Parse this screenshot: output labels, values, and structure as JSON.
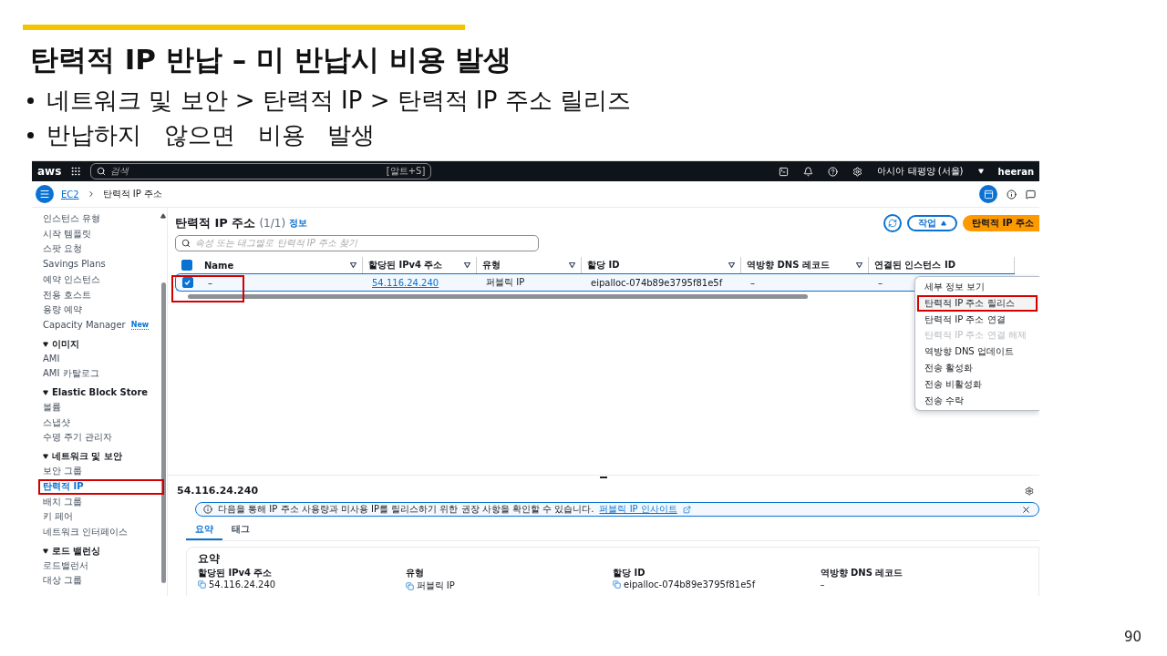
{
  "slide": {
    "title": "탄력적 IP 반납 – 미 반납시 비용 발생",
    "bullets": [
      "네트워크 및 보안 > 탄력적 IP > 탄력적 IP 주소 릴리즈",
      "반납하지   않으면   비용   발생"
    ],
    "page_number": "90"
  },
  "console": {
    "top_bar": {
      "logo": "aws",
      "search_placeholder": "검색",
      "shortcut": "[알트+S]",
      "region": "아시아 태평양 (서울)",
      "user": "heeran"
    },
    "breadcrumb": [
      {
        "label": "EC2",
        "link": true
      },
      {
        "label": "탄력적 IP 주소",
        "link": false
      }
    ],
    "sidebar": {
      "items": [
        {
          "kind": "link",
          "label": "인스턴스 유형",
          "selected": false,
          "annotated": false
        },
        {
          "kind": "link",
          "label": "시작 템플릿",
          "selected": false,
          "annotated": false
        },
        {
          "kind": "link",
          "label": "스팟 요청",
          "selected": false,
          "annotated": false
        },
        {
          "kind": "link",
          "label": "Savings Plans",
          "selected": false,
          "annotated": false
        },
        {
          "kind": "link",
          "label": "예약 인스턴스",
          "selected": false,
          "annotated": false
        },
        {
          "kind": "link",
          "label": "전용 호스트",
          "selected": false,
          "annotated": false
        },
        {
          "kind": "link",
          "label": "용량 예약",
          "selected": false,
          "annotated": false
        },
        {
          "kind": "link",
          "label": "Capacity Manager",
          "badge": "New",
          "selected": false,
          "annotated": false
        },
        {
          "kind": "section",
          "label": "이미지",
          "expanded": true,
          "children": [
            {
              "kind": "link",
              "label": "AMI",
              "selected": false,
              "annotated": false
            },
            {
              "kind": "link",
              "label": "AMI 카탈로그",
              "selected": false,
              "annotated": false
            }
          ]
        },
        {
          "kind": "section",
          "label": "Elastic Block Store",
          "expanded": true,
          "children": [
            {
              "kind": "link",
              "label": "볼륨",
              "selected": false,
              "annotated": false
            },
            {
              "kind": "link",
              "label": "스냅샷",
              "selected": false,
              "annotated": false
            },
            {
              "kind": "link",
              "label": "수명 주기 관리자",
              "selected": false,
              "annotated": false
            }
          ]
        },
        {
          "kind": "section",
          "label": "네트워크 및 보안",
          "expanded": true,
          "children": [
            {
              "kind": "link",
              "label": "보안 그룹",
              "selected": false,
              "annotated": false
            },
            {
              "kind": "link",
              "label": "탄력적 IP",
              "selected": true,
              "annotated": true
            },
            {
              "kind": "link",
              "label": "배치 그룹",
              "selected": false,
              "annotated": false
            },
            {
              "kind": "link",
              "label": "키 페어",
              "selected": false,
              "annotated": false
            },
            {
              "kind": "link",
              "label": "네트워크 인터페이스",
              "selected": false,
              "annotated": false
            }
          ]
        },
        {
          "kind": "section",
          "label": "로드 밸런싱",
          "expanded": true,
          "children": [
            {
              "kind": "link",
              "label": "로드밸런서",
              "selected": false,
              "annotated": false
            },
            {
              "kind": "link",
              "label": "대상 그룹",
              "selected": false,
              "annotated": false
            }
          ]
        }
      ]
    },
    "list": {
      "title": "탄력적 IP 주소",
      "count": "(1/1)",
      "info": "정보",
      "actions_button": "작업",
      "actions_expanded": true,
      "primary_button": "탄력적 IP 주소",
      "search_placeholder": "속성 또는 태그별로 탄력적 IP 주소 찾기",
      "all_checked": true,
      "columns": [
        {
          "label": "Name",
          "kind": "text"
        },
        {
          "label": "할당된 IPv4 주소",
          "kind": "link"
        },
        {
          "label": "유형",
          "kind": "text"
        },
        {
          "label": "할당 ID",
          "kind": "text"
        },
        {
          "label": "역방향 DNS 레코드",
          "kind": "text"
        },
        {
          "label": "연결된 인스턴스 ID",
          "kind": "text"
        }
      ],
      "rows": [
        {
          "cells": [
            "–",
            "54.116.24.240",
            "퍼블릭 IP",
            "eipalloc-074b89e3795f81e5f",
            "–",
            "–"
          ],
          "selected": true,
          "annotated": true
        }
      ]
    },
    "actions_menu": [
      {
        "label": "세부 정보 보기",
        "disabled": false,
        "annotated": false
      },
      {
        "label": "탄력적 IP 주소 릴리스",
        "disabled": false,
        "annotated": true
      },
      {
        "label": "탄력적 IP 주소 연결",
        "disabled": false,
        "annotated": false
      },
      {
        "label": "탄력적 IP 주소 연결 해제",
        "disabled": true,
        "annotated": false
      },
      {
        "label": "역방향 DNS 업데이트",
        "disabled": false,
        "annotated": false
      },
      {
        "label": "전송 활성화",
        "disabled": false,
        "annotated": false
      },
      {
        "label": "전송 비활성화",
        "disabled": false,
        "annotated": false
      },
      {
        "label": "전송 수락",
        "disabled": false,
        "annotated": false
      }
    ],
    "details": {
      "title": "54.116.24.240",
      "alert": {
        "text": "다음을 통해 IP 주소 사용량과 미사용 IP를 릴리스하기 위한 권장 사항을 확인할 수 있습니다.",
        "link": "퍼블릭 IP 인사이트"
      },
      "tabs": [
        {
          "label": "요약",
          "selected": true
        },
        {
          "label": "태그",
          "selected": false
        }
      ],
      "summary": {
        "title": "요약",
        "fields": [
          {
            "label": "할당된 IPv4 주소",
            "value": "54.116.24.240",
            "copyable": true
          },
          {
            "label": "유형",
            "value": "퍼블릭 IP",
            "copyable": true
          },
          {
            "label": "할당 ID",
            "value": "eipalloc-074b89e3795f81e5f",
            "copyable": true
          },
          {
            "label": "역방향 DNS 레코드",
            "value": "–",
            "copyable": false
          }
        ]
      }
    }
  }
}
